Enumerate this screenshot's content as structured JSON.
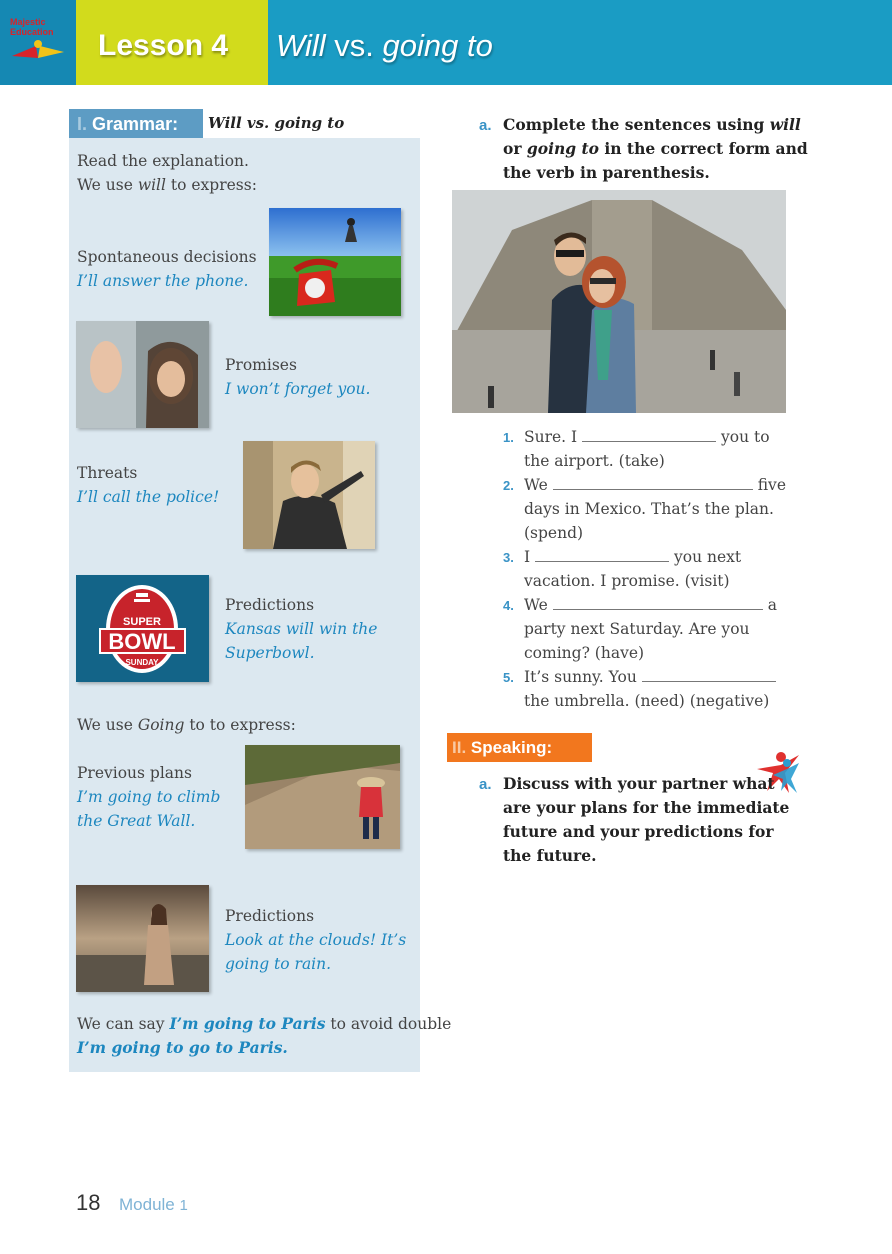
{
  "header": {
    "logo_text_1": "Majestic",
    "logo_text_2": "Education",
    "lesson_label": "Lesson 4",
    "title_will": "Will",
    "title_vs": " vs. ",
    "title_going": "going to"
  },
  "grammar": {
    "num": "I.",
    "label": "Grammar:",
    "subtitle": "Will vs. going to",
    "intro_1": "Read the explanation.",
    "intro_2_pre": "We use ",
    "intro_2_em": "will",
    "intro_2_post": " to express:",
    "items": [
      {
        "heading": "Spontaneous decisions",
        "example": "I’ll answer the phone."
      },
      {
        "heading": "Promises",
        "example": "I won’t forget you."
      },
      {
        "heading": "Threats",
        "example": "I’ll call the police!"
      },
      {
        "heading": "Predictions",
        "example_1": "Kansas will win the",
        "example_2": "Superbowl."
      }
    ],
    "going_pre": "We use ",
    "going_em": "Going",
    "going_post": " to to express:",
    "going_items": [
      {
        "heading": "Previous plans",
        "example_1": "I’m going to climb",
        "example_2": "the Great Wall."
      },
      {
        "heading": "Predictions",
        "example_1": "Look at the clouds! It’s",
        "example_2": "going to rain."
      }
    ],
    "note_pre": "We can say ",
    "note_em": "I’m going to Paris",
    "note_post": " to avoid double",
    "note_line2": "I’m going to go to Paris.",
    "superbowl_1": "SUPER",
    "superbowl_2": "BOWL",
    "superbowl_3": "SUNDAY"
  },
  "exercise_a": {
    "letter": "a.",
    "line1_pre": "Complete the sentences using ",
    "line1_em": "will",
    "line2_pre": "or ",
    "line2_em": "going to",
    "line2_post": " in the correct form and",
    "line3": "the verb in parenthesis.",
    "questions": [
      {
        "num": "1.",
        "l1_pre": "Sure. I",
        "l1_post": "you to",
        "l2": "the airport. (take)"
      },
      {
        "num": "2.",
        "l1_pre": "We",
        "l1_post": "five",
        "l2": "days in Mexico. That’s the plan.",
        "l3": "(spend)"
      },
      {
        "num": "3.",
        "l1_pre": "I",
        "l1_post": "you next",
        "l2": "vacation. I promise. (visit)"
      },
      {
        "num": "4.",
        "l1_pre": "We",
        "l1_post": "a",
        "l2": "party next Saturday. Are you",
        "l3": "coming? (have)"
      },
      {
        "num": "5.",
        "l1_pre": "It’s sunny. You",
        "l2": "the umbrella. (need) (negative)"
      }
    ]
  },
  "speaking": {
    "num": "II.",
    "label": "Speaking:",
    "letter": "a.",
    "lines": [
      "Discuss with your partner what",
      "are your plans for the immediate",
      "future and your predictions for",
      "the future."
    ]
  },
  "footer": {
    "page_number": "18",
    "module_label": "Module",
    "module_number": "1"
  }
}
